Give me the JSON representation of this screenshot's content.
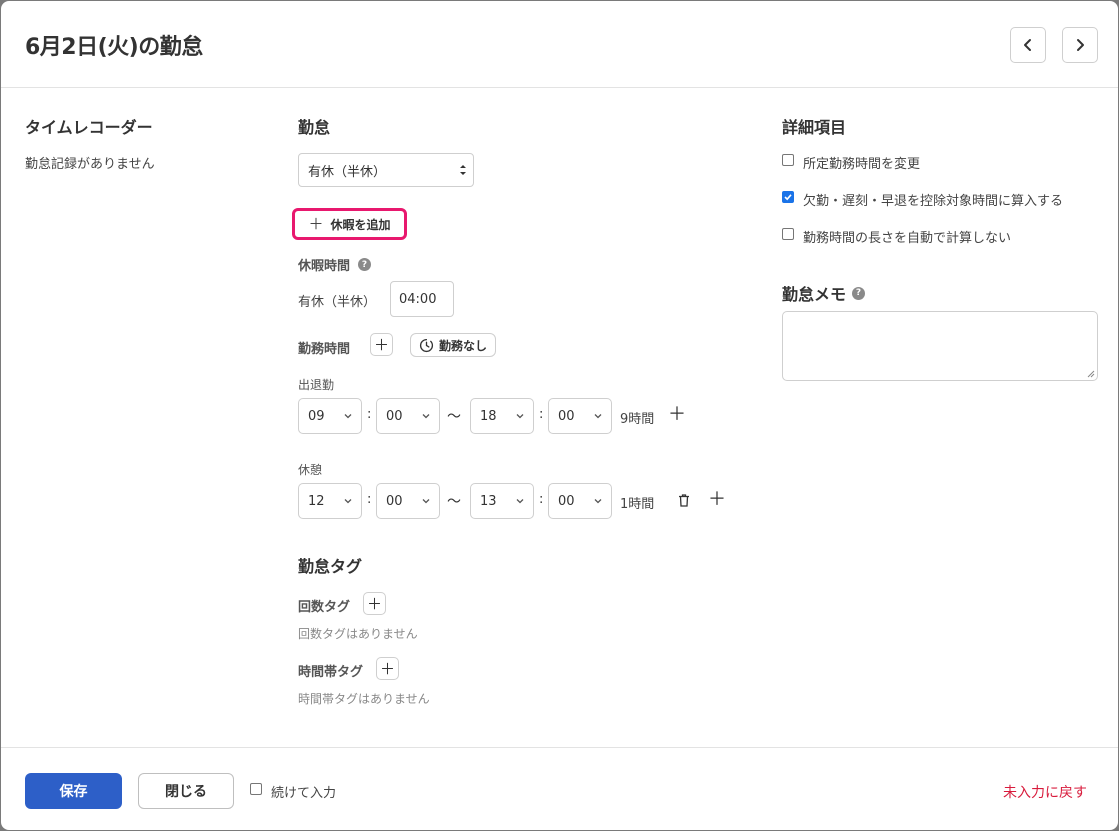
{
  "header": {
    "title": "6月2日(火)の勤怠",
    "prev_icon": "chevron-left-icon",
    "next_icon": "chevron-right-icon"
  },
  "time_recorder": {
    "heading": "タイムレコーダー",
    "empty_text": "勤怠記録がありません"
  },
  "attendance": {
    "heading": "勤怠",
    "type_value": "有休（半休）",
    "add_leave_label": "休暇を追加",
    "leave_time_label": "休暇時間",
    "leave_type_label": "有休（半休）",
    "leave_time_value": "04:00",
    "work_time_label": "勤務時間",
    "no_work_label": "勤務なし",
    "clock": {
      "label": "出退勤",
      "start_hour": "09",
      "start_min": "00",
      "end_hour": "18",
      "end_min": "00",
      "duration": "9時間"
    },
    "break": {
      "label": "休憩",
      "start_hour": "12",
      "start_min": "00",
      "end_hour": "13",
      "end_min": "00",
      "duration": "1時間"
    },
    "separator": "～"
  },
  "tags": {
    "heading": "勤怠タグ",
    "count_label": "回数タグ",
    "count_empty": "回数タグはありません",
    "timezone_label": "時間帯タグ",
    "timezone_empty": "時間帯タグはありません"
  },
  "details": {
    "heading": "詳細項目",
    "options": [
      {
        "label": "所定勤務時間を変更",
        "checked": false
      },
      {
        "label": "欠勤・遅刻・早退を控除対象時間に算入する",
        "checked": true
      },
      {
        "label": "勤務時間の長さを自動で計算しない",
        "checked": false
      }
    ]
  },
  "memo": {
    "heading": "勤怠メモ",
    "value": ""
  },
  "footer": {
    "save_label": "保存",
    "close_label": "閉じる",
    "continue_label": "続けて入力",
    "continue_checked": false,
    "revert_label": "未入力に戻す"
  },
  "colors": {
    "primary": "#2d5fc8",
    "highlight": "#e8186e",
    "danger": "#d81b3c",
    "checkbox": "#1a73e8"
  }
}
